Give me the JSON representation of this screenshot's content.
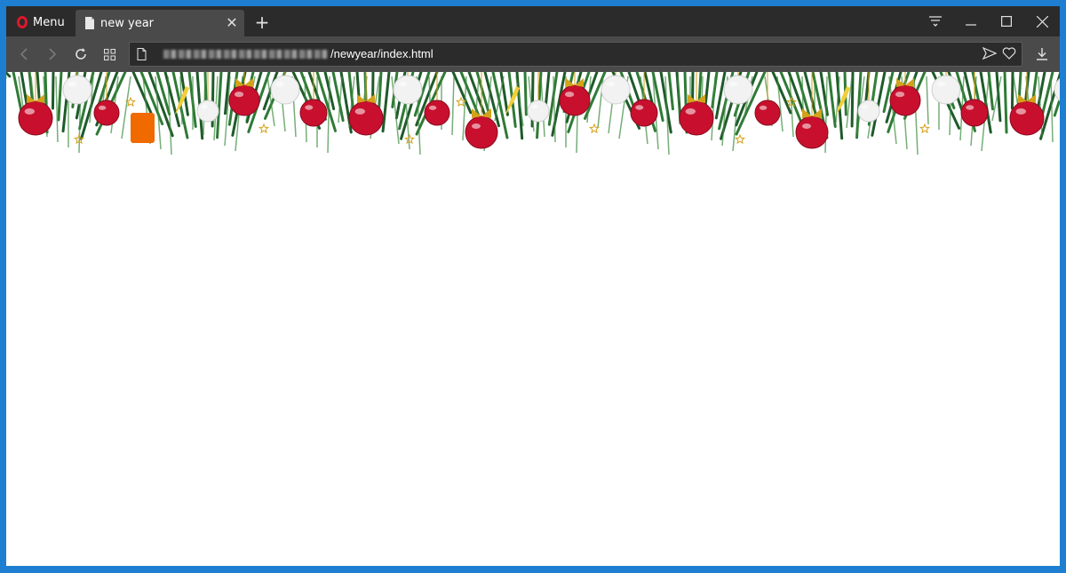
{
  "browser": {
    "menu_label": "Menu",
    "tab": {
      "title": "new year"
    },
    "new_tab_symbol": "+",
    "close_tab_symbol": "✕"
  },
  "address_bar": {
    "url_visible": "/newyear/index.html"
  },
  "colors": {
    "window_frame": "#1e7fd2",
    "titlebar": "#2b2b2b",
    "toolbar": "#4a4a4a",
    "opera_red": "#e0162b",
    "ornament_red": "#c8102e",
    "ornament_gold": "#d4a21a",
    "orange_square": "#f06a00"
  },
  "icons": {
    "tab": "document-icon",
    "back": "back-arrow-icon",
    "forward": "forward-arrow-icon",
    "reload": "reload-icon",
    "speed_dial": "grid-icon",
    "send": "send-icon",
    "bookmark": "heart-icon",
    "download": "download-icon",
    "easy_setup": "easy-setup-icon"
  }
}
